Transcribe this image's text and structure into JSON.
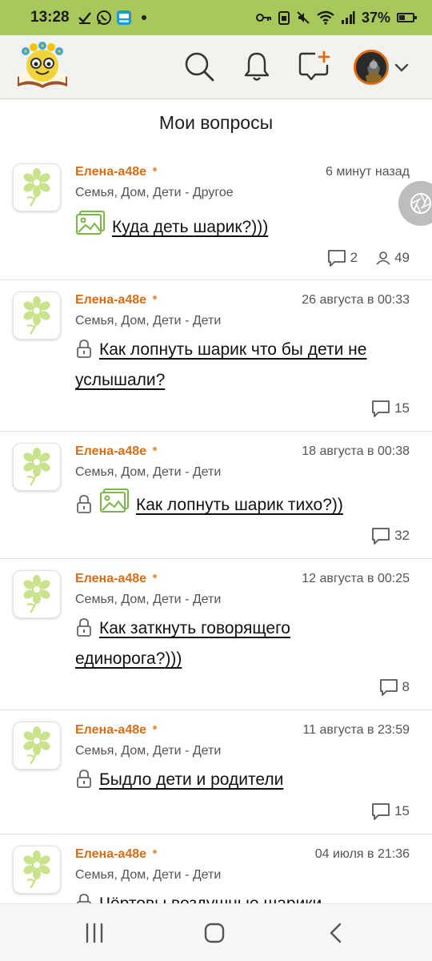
{
  "status_bar": {
    "time": "13:28",
    "battery_text": "37%",
    "battery_level": 0.37
  },
  "app_bar": {
    "logo_icon": "smiling-book-logo-icon",
    "icons": [
      "search-icon",
      "bell-icon",
      "add-question-icon",
      "avatar",
      "chevron-down-icon"
    ],
    "accent_color": "#e06a10"
  },
  "page_title": "Мои вопросы",
  "questions": [
    {
      "author": "Елена-а48е",
      "time": "6 минут назад",
      "category": "Семья, Дом, Дети - Другое",
      "title": "Куда деть шарик?)))",
      "locked": false,
      "has_image": true,
      "answers": "2",
      "views": "49"
    },
    {
      "author": "Елена-а48е",
      "time": "26 августа в 00:33",
      "category": "Семья, Дом, Дети - Дети",
      "title": "Как лопнуть шарик что бы дети не услышали?",
      "locked": true,
      "has_image": false,
      "answers": "15"
    },
    {
      "author": "Елена-а48е",
      "time": "18 августа в 00:38",
      "category": "Семья, Дом, Дети - Дети",
      "title": "Как лопнуть шарик тихо?))",
      "locked": true,
      "has_image": true,
      "answers": "32"
    },
    {
      "author": "Елена-а48е",
      "time": "12 августа в 00:25",
      "category": "Семья, Дом, Дети - Дети",
      "title": "Как заткнуть говорящего единорога?)))",
      "locked": true,
      "has_image": false,
      "answers": "8"
    },
    {
      "author": "Елена-а48е",
      "time": "11 августа в 23:59",
      "category": "Семья, Дом, Дети - Дети",
      "title": "Быдло дети и родители",
      "locked": true,
      "has_image": false,
      "answers": "15"
    },
    {
      "author": "Елена-а48е",
      "time": "04 июля в 21:36",
      "category": "Семья, Дом, Дети - Дети",
      "title": "Чёртовы воздушные шарики",
      "locked": true,
      "has_image": false,
      "answers": ""
    }
  ],
  "colors": {
    "status_bar": "#a8c85b",
    "author": "#d96d12",
    "flower": "#c9e38d"
  },
  "nav_bar": {
    "icons": [
      "recent-apps-icon",
      "home-icon",
      "back-icon"
    ]
  }
}
